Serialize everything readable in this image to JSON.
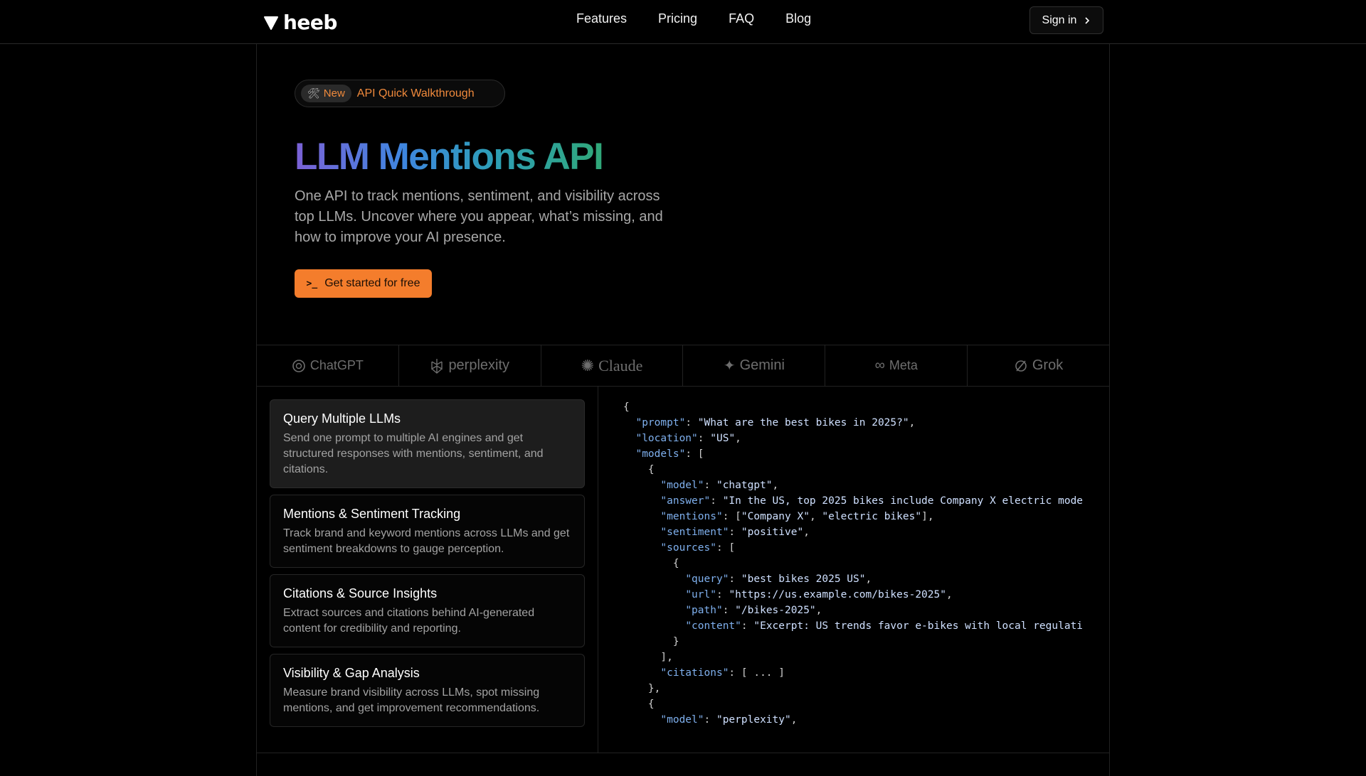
{
  "brand": {
    "name": "heeb"
  },
  "nav": {
    "items": [
      "Features",
      "Pricing",
      "FAQ",
      "Blog"
    ],
    "signin_label": "Sign in"
  },
  "badge": {
    "new_label": "New",
    "text": "API Quick Walkthrough"
  },
  "hero": {
    "title": "LLM Mentions API",
    "subtitle": "One API to track mentions, sentiment, and visibility across top LLMs. Uncover where you appear, what’s missing, and how to improve your AI presence.",
    "cta_label": "Get started for free"
  },
  "llm_logos": [
    "ChatGPT",
    "perplexity",
    "Claude",
    "Gemini",
    "Meta",
    "Grok"
  ],
  "features": [
    {
      "title": "Query Multiple LLMs",
      "desc": "Send one prompt to multiple AI engines and get structured responses with mentions, sentiment, and citations."
    },
    {
      "title": "Mentions & Sentiment Tracking",
      "desc": "Track brand and keyword mentions across LLMs and get sentiment breakdowns to gauge perception."
    },
    {
      "title": "Citations & Source Insights",
      "desc": "Extract sources and citations behind AI-generated content for credibility and reporting."
    },
    {
      "title": "Visibility & Gap Analysis",
      "desc": "Measure brand visibility across LLMs, spot missing mentions, and get improvement recommendations."
    }
  ],
  "code_lines": [
    "{",
    "  \"prompt\": \"What are the best bikes in 2025?\",",
    "  \"location\": \"US\",",
    "  \"models\": [",
    "    {",
    "      \"model\": \"chatgpt\",",
    "      \"answer\": \"In the US, top 2025 bikes include Company X electric mode",
    "      \"mentions\": [\"Company X\", \"electric bikes\"],",
    "      \"sentiment\": \"positive\",",
    "      \"sources\": [",
    "        {",
    "          \"query\": \"best bikes 2025 US\",",
    "          \"url\": \"https://us.example.com/bikes-2025\",",
    "          \"path\": \"/bikes-2025\",",
    "          \"content\": \"Excerpt: US trends favor e-bikes with local regulati",
    "        }",
    "      ],",
    "      \"citations\": [ ... ]",
    "    },",
    "    {",
    "      \"model\": \"perplexity\","
  ],
  "colors": {
    "accent": "#f47d2c",
    "code_key": "#7fb0ee"
  }
}
